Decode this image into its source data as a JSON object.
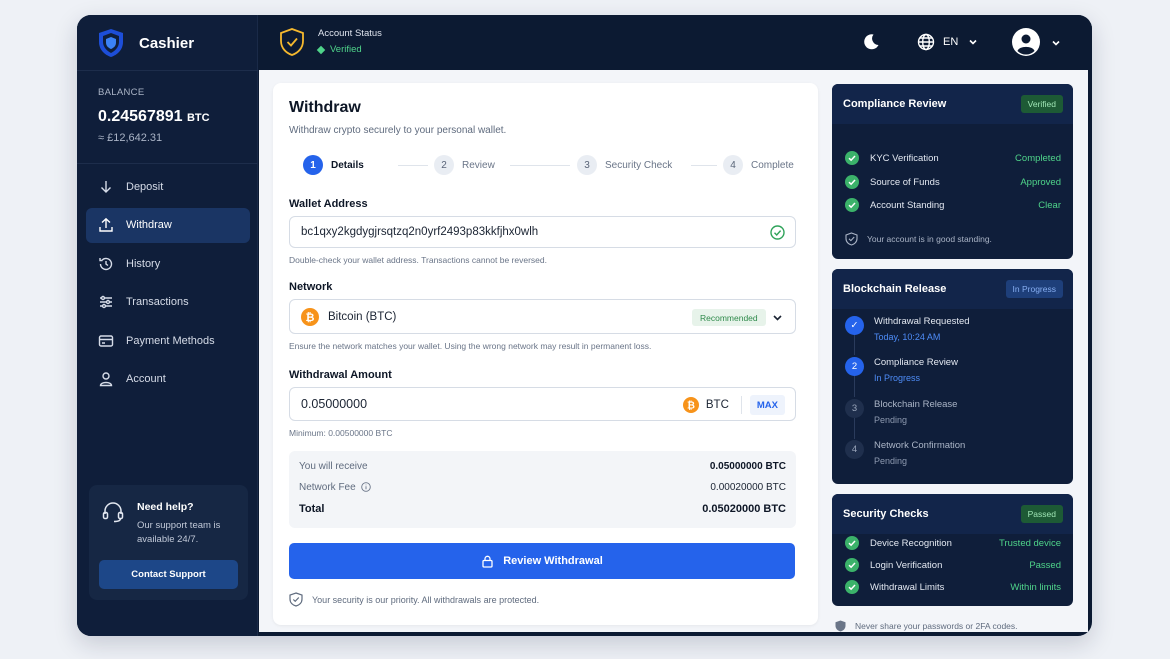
{
  "brand": {
    "name": "Cashier"
  },
  "balance": {
    "label": "BALANCE",
    "amount": "0.24567891",
    "unit": "BTC",
    "fiat": "≈ £12,642.31"
  },
  "nav": [
    {
      "label": "Deposit",
      "icon": "arrow-down-icon",
      "active": false
    },
    {
      "label": "Withdraw",
      "icon": "arrow-up-icon",
      "active": true
    },
    {
      "label": "History",
      "icon": "history-icon",
      "active": false
    },
    {
      "label": "Transactions",
      "icon": "sliders-icon",
      "active": false
    },
    {
      "label": "Payment Methods",
      "icon": "card-icon",
      "active": false
    },
    {
      "label": "Account",
      "icon": "user-icon",
      "active": false
    }
  ],
  "help": {
    "title": "Need help?",
    "text": "Our support team is available 24/7.",
    "button": "Contact Support"
  },
  "topbar": {
    "status_title": "Account Status",
    "status_value": "Verified",
    "language": "EN"
  },
  "withdraw": {
    "title": "Withdraw",
    "subtitle": "Withdraw crypto securely to your personal wallet.",
    "steps": [
      {
        "num": "1",
        "label": "Details",
        "active": true
      },
      {
        "num": "2",
        "label": "Review",
        "active": false
      },
      {
        "num": "3",
        "label": "Security Check",
        "active": false
      },
      {
        "num": "4",
        "label": "Complete",
        "active": false
      }
    ],
    "wallet_label": "Wallet Address",
    "wallet_value": "bc1qxy2kgdygjrsqtzq2n0yrf2493p83kkfjhx0wlh",
    "wallet_hint": "Double-check your wallet address. Transactions cannot be reversed.",
    "network_label": "Network",
    "network_value": "Bitcoin (BTC)",
    "network_badge": "Recommended",
    "network_hint": "Ensure the network matches your wallet. Using the wrong network may result in permanent loss.",
    "amount_label": "Withdrawal Amount",
    "amount_value": "0.05000000",
    "amount_unit": "BTC",
    "max_label": "MAX",
    "amount_hint": "Minimum: 0.00500000 BTC",
    "summary": {
      "receive_label": "You will receive",
      "receive_value": "0.05000000 BTC",
      "fee_label": "Network Fee",
      "fee_value": "0.00020000 BTC",
      "total_label": "Total",
      "total_value": "0.05020000 BTC"
    },
    "submit": "Review Withdrawal",
    "footnote": "Your security is our priority. All withdrawals are protected."
  },
  "compliance": {
    "title": "Compliance Review",
    "badge": "Verified",
    "rows": [
      {
        "label": "KYC Verification",
        "value": "Completed"
      },
      {
        "label": "Source of Funds",
        "value": "Approved"
      },
      {
        "label": "Account Standing",
        "value": "Clear"
      }
    ],
    "footer": "Your account is in good standing."
  },
  "release": {
    "title": "Blockchain Release",
    "badge": "In Progress",
    "items": [
      {
        "num": "✓",
        "title": "Withdrawal Requested",
        "sub": "Today, 10:24 AM",
        "state": "done"
      },
      {
        "num": "2",
        "title": "Compliance Review",
        "sub": "In Progress",
        "state": "cur"
      },
      {
        "num": "3",
        "title": "Blockchain Release",
        "sub": "Pending",
        "state": "pend"
      },
      {
        "num": "4",
        "title": "Network Confirmation",
        "sub": "Pending",
        "state": "pend"
      }
    ]
  },
  "security": {
    "title": "Security Checks",
    "badge": "Passed",
    "rows": [
      {
        "label": "Device Recognition",
        "value": "Trusted device"
      },
      {
        "label": "Login Verification",
        "value": "Passed"
      },
      {
        "label": "Withdrawal Limits",
        "value": "Within limits"
      }
    ]
  },
  "outer_note": "Never share your passwords or 2FA codes.",
  "colors": {
    "accent": "#2563eb",
    "sidebar": "#0f1e3a",
    "success": "#4fd48a",
    "bitcoin": "#f7931a"
  }
}
